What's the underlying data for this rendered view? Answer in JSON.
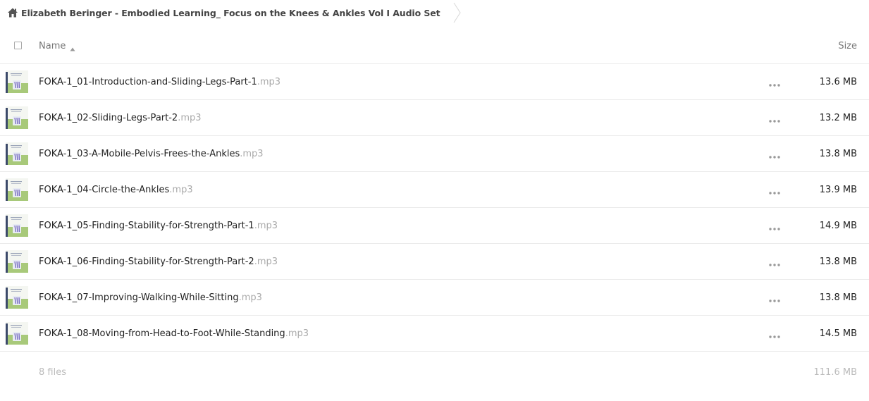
{
  "breadcrumb": {
    "home_icon": "home-icon",
    "folder_title": "Elizabeth Beringer - Embodied Learning_ Focus on the Knees & Ankles Vol I Audio Set"
  },
  "table": {
    "columns": {
      "name": "Name",
      "size": "Size"
    },
    "sort": {
      "column": "name",
      "direction": "ascending"
    },
    "files": [
      {
        "basename": "FOKA-1_01-Introduction-and-Sliding-Legs-Part-1",
        "ext": ".mp3",
        "size": "13.6 MB"
      },
      {
        "basename": "FOKA-1_02-Sliding-Legs-Part-2",
        "ext": ".mp3",
        "size": "13.2 MB"
      },
      {
        "basename": "FOKA-1_03-A-Mobile-Pelvis-Frees-the-Ankles",
        "ext": ".mp3",
        "size": "13.8 MB"
      },
      {
        "basename": "FOKA-1_04-Circle-the-Ankles",
        "ext": ".mp3",
        "size": "13.9 MB"
      },
      {
        "basename": "FOKA-1_05-Finding-Stability-for-Strength-Part-1",
        "ext": ".mp3",
        "size": "14.9 MB"
      },
      {
        "basename": "FOKA-1_06-Finding-Stability-for-Strength-Part-2",
        "ext": ".mp3",
        "size": "13.8 MB"
      },
      {
        "basename": "FOKA-1_07-Improving-Walking-While-Sitting",
        "ext": ".mp3",
        "size": "13.8 MB"
      },
      {
        "basename": "FOKA-1_08-Moving-from-Head-to-Foot-While-Standing",
        "ext": ".mp3",
        "size": "14.5 MB"
      }
    ],
    "summary": {
      "count": "8 files",
      "total_size": "111.6 MB"
    }
  },
  "colors": {
    "ext_text": "#aaaaaa",
    "row_border": "#ebebeb",
    "summary_text": "#bbbbbb",
    "thumb_green": "#a8c97a",
    "thumb_purple": "#7b6fc4"
  }
}
